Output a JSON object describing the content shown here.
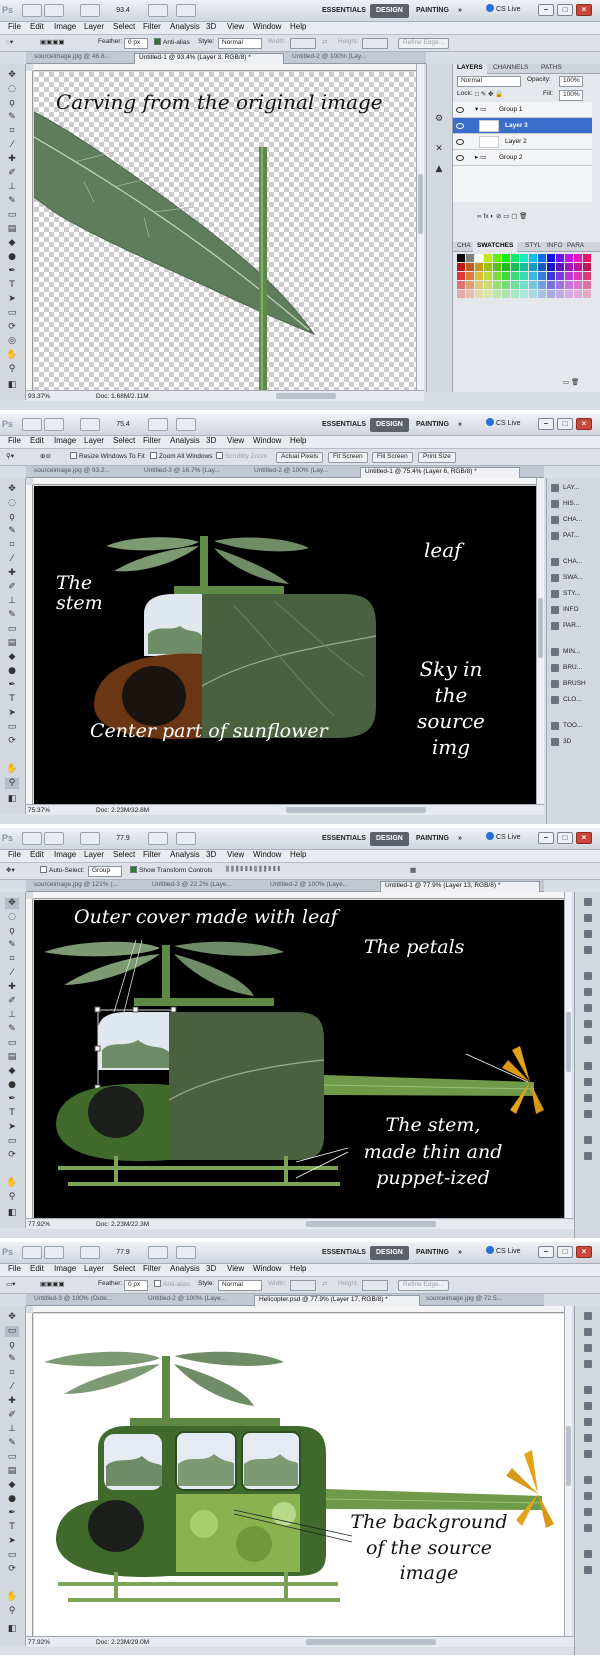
{
  "app": {
    "logo": "Ps",
    "workspaces": [
      "ESSENTIALS",
      "DESIGN",
      "PAINTING"
    ],
    "overflow": "»",
    "cs_live": "CS Live",
    "menu": [
      "File",
      "Edit",
      "Image",
      "Layer",
      "Select",
      "Filter",
      "Analysis",
      "3D",
      "View",
      "Window",
      "Help"
    ]
  },
  "screens": [
    {
      "zoom": "93.4",
      "tabs": [
        "sourceimage.jpg @ 46.8...",
        "Untitled-1 @ 93.4% (Layer 3, RGB/8) *",
        "Untitled-2 @ 100% (Lay..."
      ],
      "options": {
        "feather_label": "Feather:",
        "feather_value": "0 px",
        "antialias": "Anti-alias",
        "style_label": "Style:",
        "style_value": "Normal",
        "width_label": "Width:",
        "height_label": "Height:",
        "refine_edge": "Refine Edge..."
      },
      "annotation": "Carving from the original image",
      "status_zoom": "93.37%",
      "status_doc": "Doc: 1.68M/2.11M",
      "layers_panel": {
        "tabs": [
          "LAYERS",
          "CHANNELS",
          "PATHS"
        ],
        "blend_mode": "Normal",
        "opacity_label": "Opacity:",
        "opacity_value": "100%",
        "lock_label": "Lock:",
        "fill_label": "Fill:",
        "fill_value": "100%",
        "layers": [
          "Group 1",
          "Layer 3",
          "Layer 2",
          "Group 2"
        ],
        "selected_layer": "Layer 3",
        "swatch_tabs": [
          "CHA",
          "SWATCHES",
          "STYL",
          "INFO",
          "PARA"
        ]
      }
    },
    {
      "zoom": "75.4",
      "tabs": [
        "sourceimage.jpg @ 93.2...",
        "Untitled-3 @ 16.7% (Lay...",
        "Untitled-2 @ 100% (Lay...",
        "Untitled-1 @ 75.4% (Layer 6, RGB/8) *"
      ],
      "options": {
        "resize": "Resize Windows To Fit",
        "zoom_all": "Zoom All Windows",
        "scrubby": "Scrubby Zoom",
        "actual_pixels": "Actual Pixels",
        "fit_screen": "Fit Screen",
        "fill_screen": "Fill Screen",
        "print_size": "Print Size"
      },
      "annotations": {
        "stem": "The stem",
        "leaf": "leaf",
        "center": "Center part of sunflower",
        "sky": "Sky in the source img"
      },
      "status_zoom": "75.37%",
      "status_doc": "Doc: 2.23M/32.8M",
      "dock": [
        "LAY...",
        "HIS...",
        "CHA...",
        "PAT...",
        "CHA...",
        "SWA...",
        "STY...",
        "INFO",
        "PAR...",
        "MIN...",
        "BRU...",
        "BRUSH",
        "CLO...",
        "TOO...",
        "3D"
      ]
    },
    {
      "zoom": "77.9",
      "tabs": [
        "sourceimage.jpg @ 121% (...",
        "Untitled-3 @ 22.2% (Laye...",
        "Untitled-2 @ 100% (Laye...",
        "Untitled-1 @ 77.9% (Layer 13, RGB/8) *"
      ],
      "options": {
        "auto_select": "Auto-Select:",
        "auto_select_value": "Group",
        "transform": "Show Transform Controls"
      },
      "annotations": {
        "outer": "Outer cover made with leaf",
        "petals": "The petals",
        "stem": "The stem, made thin and puppet-ized"
      },
      "status_zoom": "77.92%",
      "status_doc": "Doc: 2.23M/22.3M"
    },
    {
      "zoom": "77.9",
      "tabs": [
        "Untitled-3 @ 100% (Oute...",
        "Untitled-2 @ 100% (Laye...",
        "Helicopter.psd @ 77.9% (Layer 17, RGB/8) *",
        "sourceimage.jpg @ 72.5..."
      ],
      "options": {
        "feather_label": "Feather:",
        "feather_value": "0 px",
        "antialias": "Anti-alias",
        "style_label": "Style:",
        "style_value": "Normal",
        "width_label": "Width:",
        "height_label": "Height:",
        "refine_edge": "Refine Edge..."
      },
      "annotation": "The background of the source image",
      "status_zoom": "77.92%",
      "status_doc": "Doc: 2.23M/29.0M"
    }
  ],
  "colors": {
    "accent": "#3b6ecc",
    "leaf": "#5d7a55",
    "stem": "#6f9a4a",
    "petal": "#e2a319"
  }
}
